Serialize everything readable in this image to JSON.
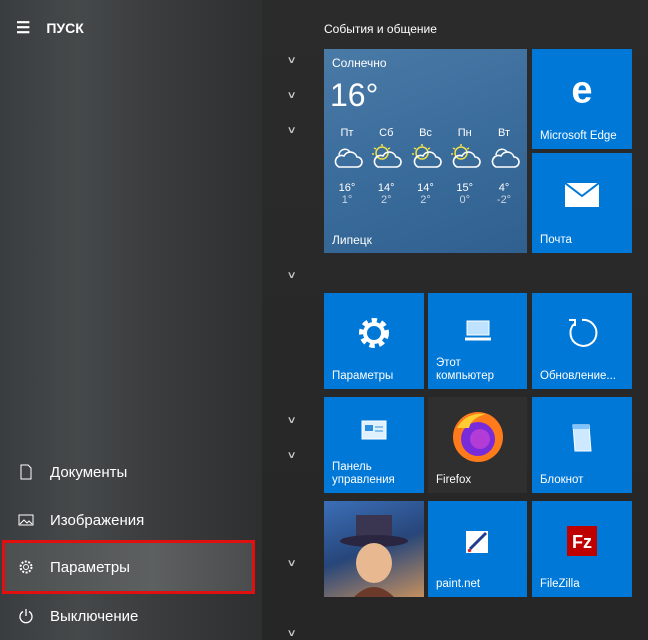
{
  "header": {
    "title": "ПУСК"
  },
  "menu": [
    {
      "label": "Документы",
      "icon": "document-icon"
    },
    {
      "label": "Изображения",
      "icon": "image-icon"
    },
    {
      "label": "Параметры",
      "icon": "gear-icon"
    },
    {
      "label": "Выключение",
      "icon": "power-icon"
    }
  ],
  "group_title": "События и общение",
  "weather": {
    "condition": "Солнечно",
    "temp": "16°",
    "city": "Липецк",
    "days": [
      {
        "d": "Пт",
        "hi": "16°",
        "lo": "1°",
        "icon": "cloudy"
      },
      {
        "d": "Сб",
        "hi": "14°",
        "lo": "2°",
        "icon": "partly-sunny"
      },
      {
        "d": "Вс",
        "hi": "14°",
        "lo": "2°",
        "icon": "partly-sunny"
      },
      {
        "d": "Пн",
        "hi": "15°",
        "lo": "0°",
        "icon": "partly-sunny"
      },
      {
        "d": "Вт",
        "hi": "4°",
        "lo": "-2°",
        "icon": "cloudy"
      }
    ]
  },
  "tiles": {
    "edge": "Microsoft Edge",
    "mail": "Почта",
    "settings": "Параметры",
    "computer": "Этот компьютер",
    "update": "Обновление...",
    "control": "Панель управления",
    "firefox": "Firefox",
    "notepad": "Блокнот",
    "paint": "paint.net",
    "filezilla": "FileZilla"
  },
  "colors": {
    "tile": "#0078d7",
    "highlight": "#e01010"
  }
}
